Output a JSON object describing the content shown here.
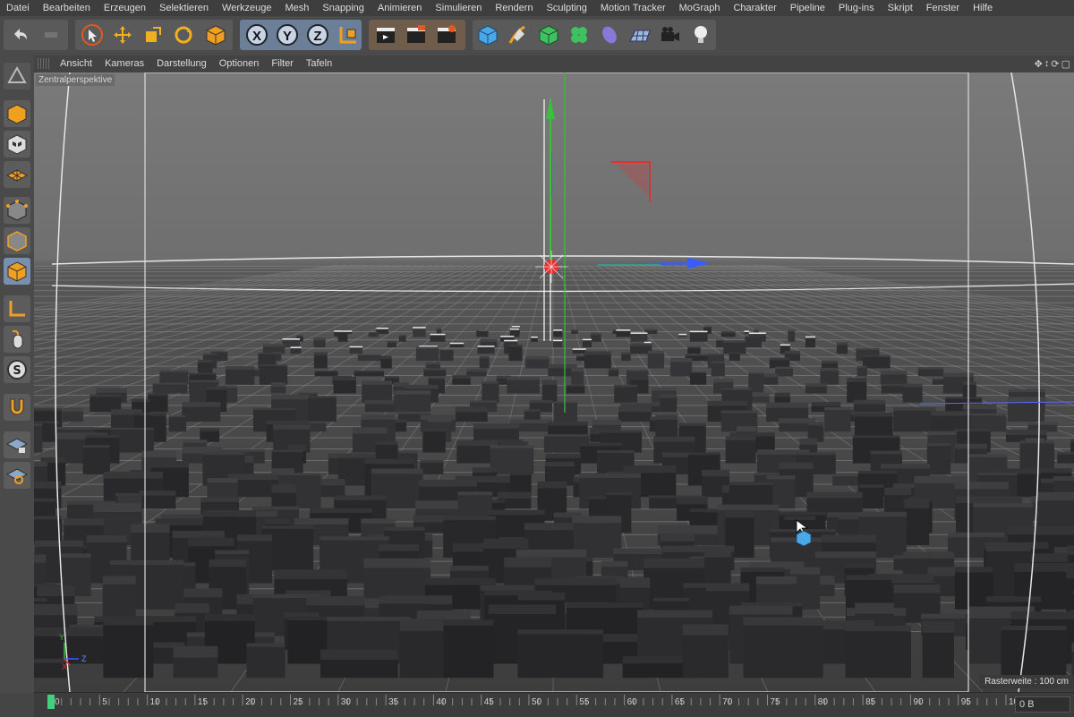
{
  "menu": [
    "Datei",
    "Bearbeiten",
    "Erzeugen",
    "Selektieren",
    "Werkzeuge",
    "Mesh",
    "Snapping",
    "Animieren",
    "Simulieren",
    "Rendern",
    "Sculpting",
    "Motion Tracker",
    "MoGraph",
    "Charakter",
    "Pipeline",
    "Plug-ins",
    "Skript",
    "Fenster",
    "Hilfe"
  ],
  "toolbar": {
    "axis_x": "X",
    "axis_y": "Y",
    "axis_z": "Z",
    "icons": [
      "undo-icon",
      "redo-icon",
      "select-icon",
      "move-icon",
      "scale-icon",
      "rotate-icon",
      "recent-object-icon",
      "axis-x-icon",
      "axis-y-icon",
      "axis-z-icon",
      "coordinate-system-icon",
      "render-view-icon",
      "render-picture-icon",
      "render-settings-icon",
      "cube-icon",
      "pen-icon",
      "subdivision-icon",
      "mograph-cloner-icon",
      "deformer-icon",
      "floor-icon",
      "camera-icon",
      "light-icon"
    ]
  },
  "viewport_menu": [
    "Ansicht",
    "Kameras",
    "Darstellung",
    "Optionen",
    "Filter",
    "Tafeln"
  ],
  "viewport": {
    "label": "Zentralperspektive",
    "raster": "Rasterweite : 100 cm",
    "axis_y": "Y",
    "axis_z": "Z",
    "axis_x": "X"
  },
  "timeline": {
    "ticks": [
      "0",
      "5",
      "10",
      "15",
      "20",
      "25",
      "30",
      "35",
      "40",
      "45",
      "50",
      "55",
      "60",
      "65",
      "70",
      "75",
      "80",
      "85",
      "90",
      "95",
      "100"
    ],
    "current_frame_field": "0 B"
  },
  "colors": {
    "accent_blue": "#7a8fae",
    "axis_red": "#e03030",
    "axis_green": "#3ac03a",
    "axis_blue": "#3a5cff",
    "timeline_marker": "#40d080"
  }
}
